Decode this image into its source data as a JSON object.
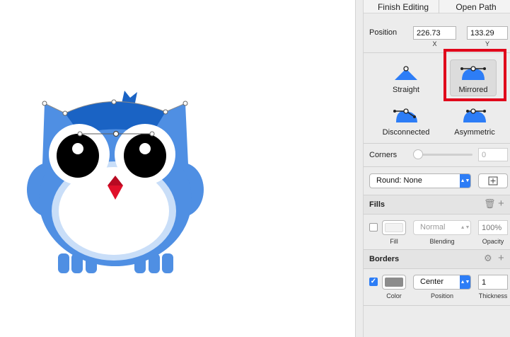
{
  "toolbar": {
    "finish_label": "Finish Editing",
    "open_path_label": "Open Path"
  },
  "position": {
    "label": "Position",
    "x_value": "226.73",
    "y_value": "133.29",
    "x_caption": "X",
    "y_caption": "Y"
  },
  "point_modes": [
    {
      "label": "Straight",
      "icon": "straight-point-icon"
    },
    {
      "label": "Mirrored",
      "icon": "mirrored-point-icon",
      "selected": true
    },
    {
      "label": "Disconnected",
      "icon": "disconnected-point-icon"
    },
    {
      "label": "Asymmetric",
      "icon": "asymmetric-point-icon"
    }
  ],
  "corners": {
    "label": "Corners",
    "value": "0",
    "slider_fraction": 0
  },
  "round": {
    "selected": "Round: None"
  },
  "fills": {
    "title": "Fills",
    "blending": "Normal",
    "opacity_placeholder": "100%",
    "captions": {
      "fill": "Fill",
      "blending": "Blending",
      "opacity": "Opacity"
    },
    "enabled": false
  },
  "borders": {
    "title": "Borders",
    "position": "Center",
    "thickness": "1",
    "captions": {
      "color": "Color",
      "position": "Position",
      "thickness": "Thickness"
    },
    "enabled": true,
    "color": "#8c8c8c"
  },
  "colors": {
    "accent": "#2d7df6",
    "highlight": "#e0001a",
    "owl_body": "#4f8fe3",
    "owl_head": "#1a63c4",
    "owl_beak": "#e0102a"
  }
}
